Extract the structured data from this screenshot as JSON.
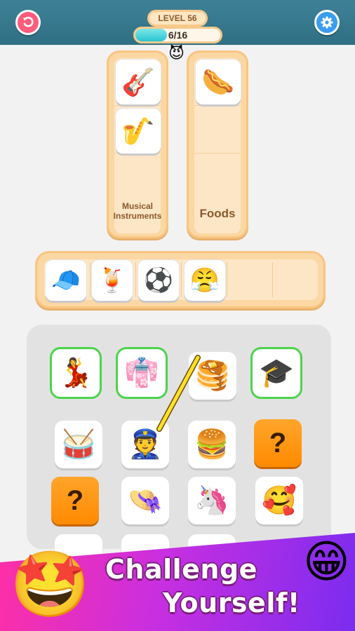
{
  "header": {
    "level_label": "LEVEL 56",
    "progress_text": "6/16",
    "progress_fraction": 0.375,
    "undo_icon": "undo-icon",
    "settings_icon": "gear-icon",
    "mascot": "😈"
  },
  "categories": [
    {
      "label": "Musical Instruments",
      "slots": [
        "🎸",
        "🎷",
        "",
        ""
      ]
    },
    {
      "label": "Foods",
      "slots": [
        "🌭",
        "",
        "",
        ""
      ]
    }
  ],
  "tray": {
    "items": [
      "🧢",
      "🍹",
      "⚽",
      "😤",
      "",
      ""
    ]
  },
  "board": {
    "rows": [
      [
        "💃",
        "👘",
        "🥞",
        "🎓"
      ],
      [
        "🥁",
        "👮",
        "🍔",
        "?"
      ],
      [
        "?",
        "👒",
        "🦄",
        "🥰"
      ]
    ],
    "highlighted": [
      "💃",
      "👘",
      "🎓"
    ]
  },
  "banner": {
    "line1": "Challenge",
    "line2": "Yourself!",
    "left_emoji": "🤩",
    "right_emoji": "😁"
  },
  "colors": {
    "header_bg": "#3e8196",
    "panel": "#fbd7a3",
    "mystery": "#ff8a00",
    "highlight": "#4cd44c",
    "banner_start": "#ff2fa5",
    "banner_end": "#7b2cf0"
  }
}
